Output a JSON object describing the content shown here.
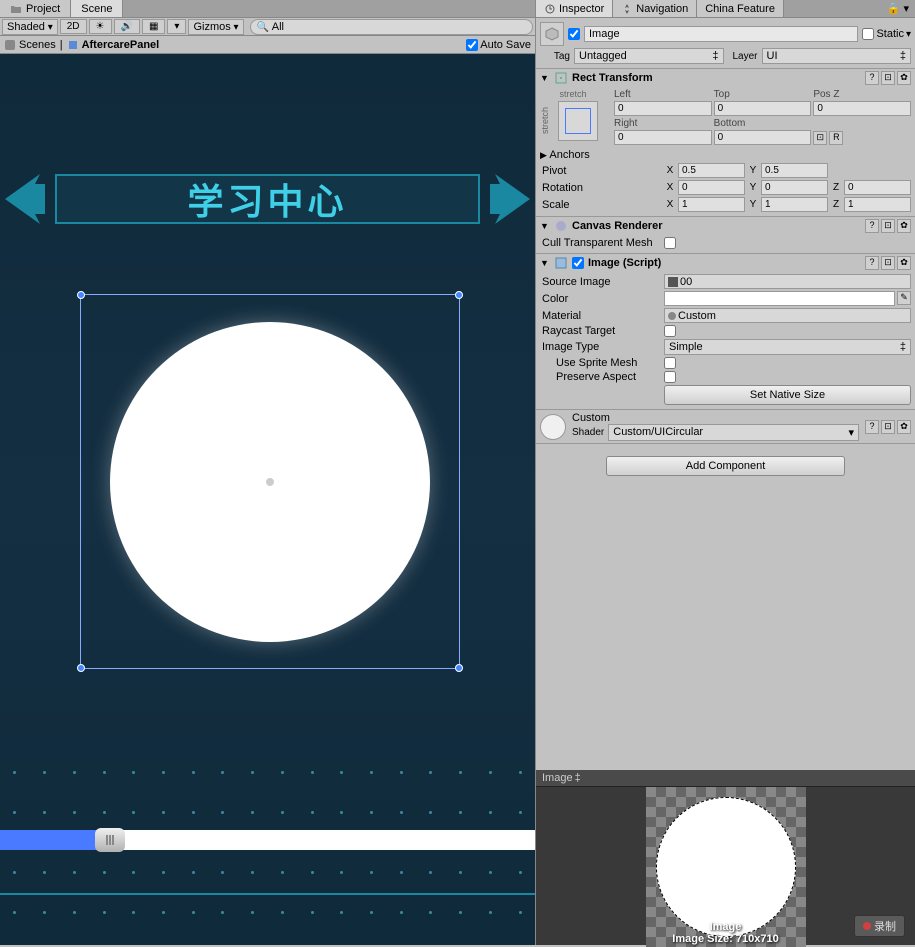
{
  "left": {
    "tabs": {
      "project": "Project",
      "scene": "Scene"
    },
    "toolbar": {
      "shaded": "Shaded",
      "mode2d": "2D",
      "gizmos": "Gizmos",
      "search": "All"
    },
    "breadcrumb": {
      "scenes": "Scenes",
      "item": "AftercarePanel",
      "autosave": "Auto Save"
    },
    "banner_text": "学习中心"
  },
  "right": {
    "tabs": {
      "inspector": "Inspector",
      "navigation": "Navigation",
      "china": "China Feature"
    },
    "go": {
      "name": "Image",
      "static": "Static",
      "tag_lbl": "Tag",
      "tag_val": "Untagged",
      "layer_lbl": "Layer",
      "layer_val": "UI"
    },
    "rect": {
      "title": "Rect Transform",
      "stretch": "stretch",
      "left_lbl": "Left",
      "top_lbl": "Top",
      "posz_lbl": "Pos Z",
      "right_lbl": "Right",
      "bottom_lbl": "Bottom",
      "left": "0",
      "top": "0",
      "posz": "0",
      "right": "0",
      "bottom": "0",
      "anchors": "Anchors",
      "pivot_lbl": "Pivot",
      "pivot_x": "0.5",
      "pivot_y": "0.5",
      "rot_lbl": "Rotation",
      "rot_x": "0",
      "rot_y": "0",
      "rot_z": "0",
      "scale_lbl": "Scale",
      "scale_x": "1",
      "scale_y": "1",
      "scale_z": "1",
      "r_btn": "R"
    },
    "canvas": {
      "title": "Canvas Renderer",
      "cull": "Cull Transparent Mesh"
    },
    "image": {
      "title": "Image (Script)",
      "src_lbl": "Source Image",
      "src_val": "00",
      "color_lbl": "Color",
      "mat_lbl": "Material",
      "mat_val": "Custom",
      "raycast_lbl": "Raycast Target",
      "type_lbl": "Image Type",
      "type_val": "Simple",
      "sprite_lbl": "Use Sprite Mesh",
      "aspect_lbl": "Preserve Aspect",
      "native_btn": "Set Native Size"
    },
    "material": {
      "name": "Custom",
      "shader_lbl": "Shader",
      "shader_val": "Custom/UICircular"
    },
    "add_comp": "Add Component",
    "preview": {
      "title": "Image",
      "name": "Image",
      "size": "Image Size: 710x710",
      "record": "录制"
    }
  }
}
